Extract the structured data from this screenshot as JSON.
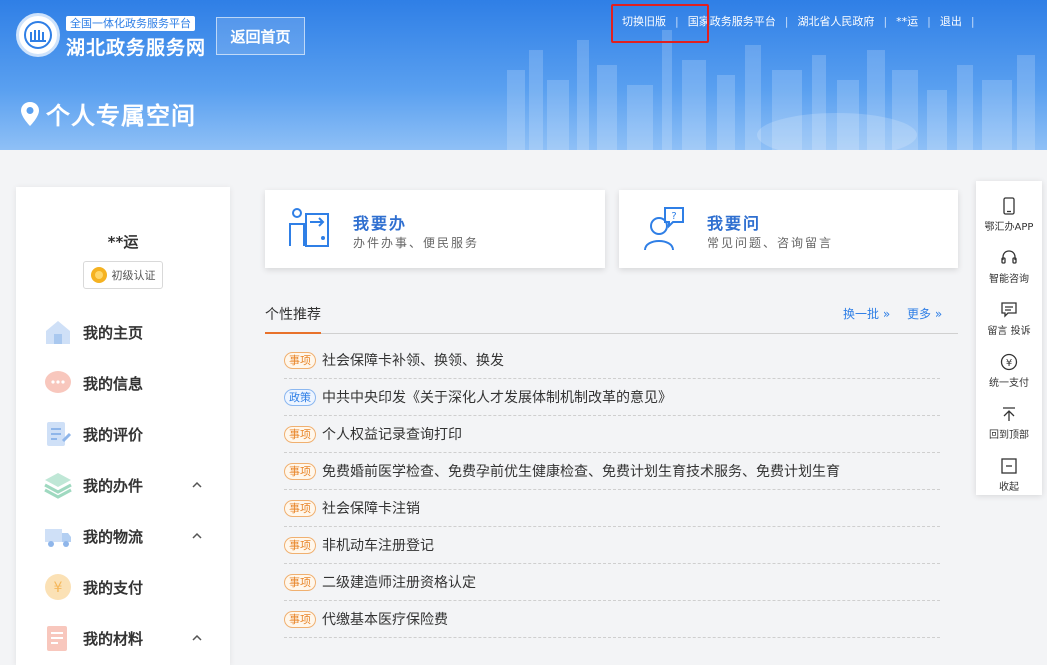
{
  "header": {
    "logo_subtitle": "全国一体化政务服务平台",
    "logo_title": "湖北政务服务网",
    "home_button": "返回首页",
    "top_links": [
      "切换旧版",
      "国家政务服务平台",
      "湖北省人民政府",
      "**运",
      "退出"
    ],
    "space_title": "个人专属空间"
  },
  "user": {
    "name": "**运",
    "certification": "初级认证"
  },
  "sidebar": {
    "items": [
      {
        "label": "我的主页",
        "icon": "home-icon",
        "expandable": false
      },
      {
        "label": "我的信息",
        "icon": "message-icon",
        "expandable": false
      },
      {
        "label": "我的评价",
        "icon": "evaluation-icon",
        "expandable": false
      },
      {
        "label": "我的办件",
        "icon": "layers-icon",
        "expandable": true
      },
      {
        "label": "我的物流",
        "icon": "truck-icon",
        "expandable": true
      },
      {
        "label": "我的支付",
        "icon": "payment-icon",
        "expandable": false
      },
      {
        "label": "我的材料",
        "icon": "materials-icon",
        "expandable": true
      }
    ]
  },
  "cards": {
    "handle": {
      "title": "我要办",
      "subtitle": "办件办事、便民服务"
    },
    "ask": {
      "title": "我要问",
      "subtitle": "常见问题、咨询留言"
    }
  },
  "recommend": {
    "title": "个性推荐",
    "refresh": "换一批",
    "more": "更多",
    "items": [
      {
        "tag": "事项",
        "type": "item",
        "text": "社会保障卡补领、换领、换发"
      },
      {
        "tag": "政策",
        "type": "policy",
        "text": "中共中央印发《关于深化人才发展体制机制改革的意见》"
      },
      {
        "tag": "事项",
        "type": "item",
        "text": "个人权益记录查询打印"
      },
      {
        "tag": "事项",
        "type": "item",
        "text": "免费婚前医学检查、免费孕前优生健康检查、免费计划生育技术服务、免费计划生育"
      },
      {
        "tag": "事项",
        "type": "item",
        "text": "社会保障卡注销"
      },
      {
        "tag": "事项",
        "type": "item",
        "text": "非机动车注册登记"
      },
      {
        "tag": "事项",
        "type": "item",
        "text": "二级建造师注册资格认定"
      },
      {
        "tag": "事项",
        "type": "item",
        "text": "代缴基本医疗保险费"
      }
    ]
  },
  "float_bar": {
    "items": [
      {
        "label": "鄂汇办APP",
        "icon": "phone-icon"
      },
      {
        "label": "智能咨询",
        "icon": "headset-icon"
      },
      {
        "label": "留言 投诉",
        "icon": "comment-icon"
      },
      {
        "label": "统一支付",
        "icon": "yuan-icon"
      },
      {
        "label": "回到顶部",
        "icon": "arrow-up-icon"
      },
      {
        "label": "收起",
        "icon": "collapse-icon"
      }
    ]
  },
  "colors": {
    "brand_blue": "#2f7fe6",
    "accent_orange": "#e8712a",
    "highlight_red": "#e02020"
  }
}
